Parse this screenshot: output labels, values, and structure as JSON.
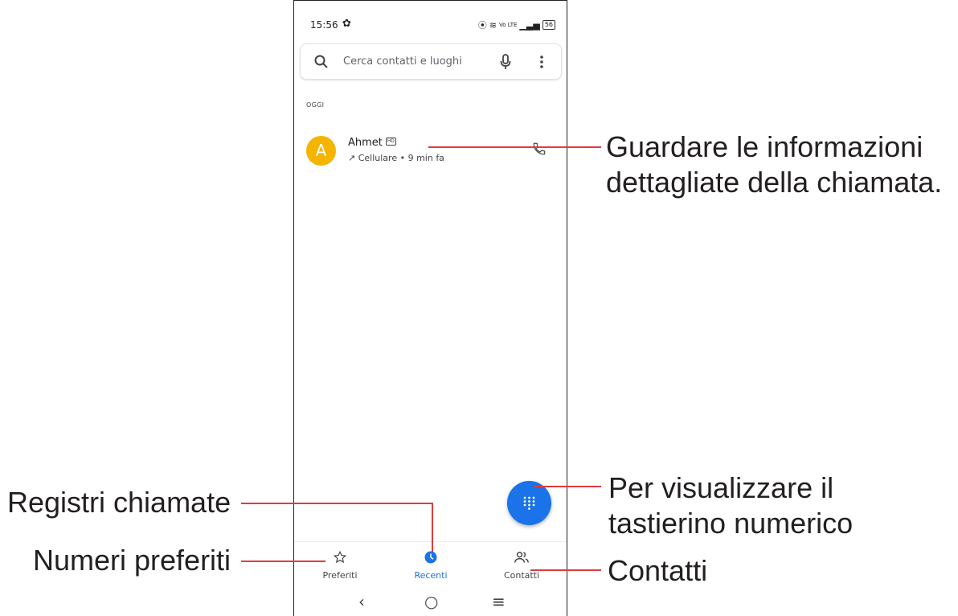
{
  "status_bar": {
    "time": "15:56",
    "icons": [
      "settings-gear",
      "vibrate",
      "wifi",
      "volte",
      "signal",
      "battery"
    ],
    "volte_text": "Vo LTE",
    "battery_level": "56"
  },
  "search": {
    "placeholder": "Cerca contatti e luoghi",
    "icons": [
      "search-icon",
      "mic-icon",
      "more-vert-icon"
    ]
  },
  "call_log": {
    "section_label": "OGGI",
    "entries": [
      {
        "initial": "A",
        "name": "Ahmet",
        "badge": "HD",
        "direction": "outgoing",
        "detail": "Cellulare • 9 min fa",
        "avatar_color": "#f4b400"
      }
    ]
  },
  "bottom_nav": {
    "items": [
      {
        "label": "Preferiti",
        "icon": "star-icon",
        "active": false
      },
      {
        "label": "Recenti",
        "icon": "clock-icon",
        "active": true
      },
      {
        "label": "Contatti",
        "icon": "people-icon",
        "active": false
      }
    ]
  },
  "callouts": {
    "call_info": [
      "Guardare le informazioni",
      "dettagliate della chiamata."
    ],
    "dialpad": [
      "Per visualizzare il",
      "tastierino numerico"
    ],
    "call_logs": "Registri chiamate",
    "favorites": "Numeri preferiti",
    "contacts": "Contatti"
  },
  "colors": {
    "accent": "#1a73e8",
    "leader_line": "#e03a3e",
    "avatar": "#f4b400"
  }
}
